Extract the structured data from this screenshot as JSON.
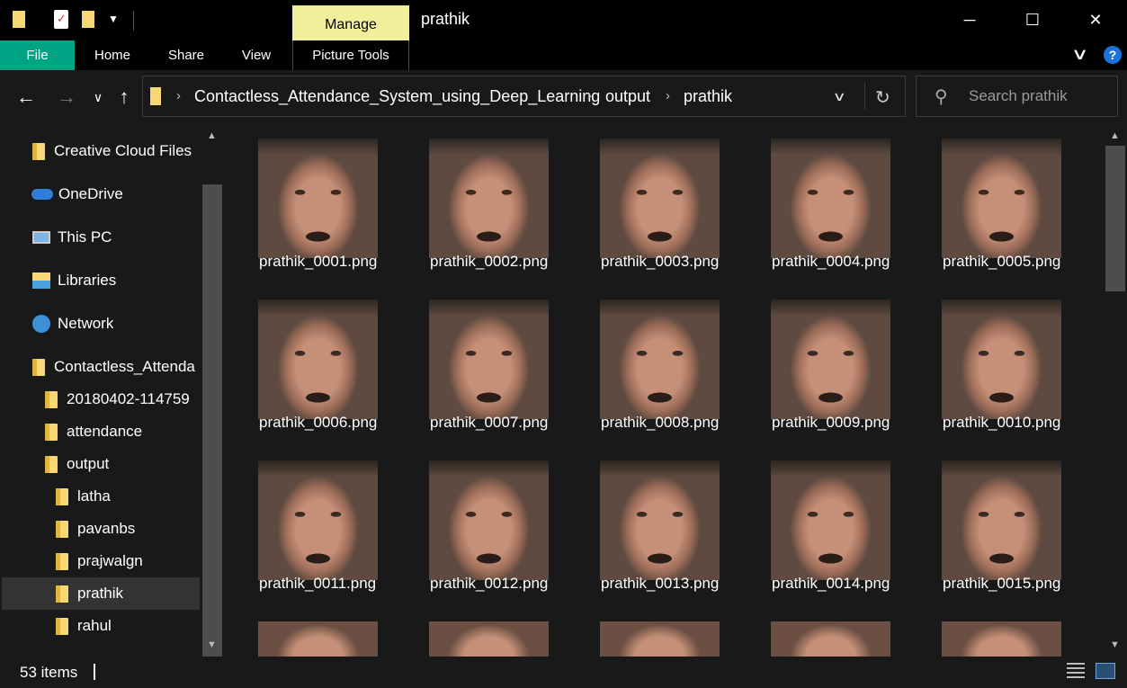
{
  "window": {
    "title": "prathik",
    "contextual_tab": "Manage",
    "controls": {
      "minimize": "─",
      "maximize": "☐",
      "close": "✕"
    }
  },
  "ribbon": {
    "tabs": [
      "File",
      "Home",
      "Share",
      "View",
      "Picture Tools"
    ],
    "collapse_icon": "chevron-down-icon",
    "help_label": "?"
  },
  "address": {
    "crumbs": [
      "Contactless_Attendance_System_using_Deep_Learning",
      "output",
      "prathik"
    ]
  },
  "search": {
    "placeholder": "Search prathik"
  },
  "navigation": {
    "items": [
      {
        "label": "Creative Cloud Files",
        "icon": "creative-cloud-icon"
      },
      {
        "label": "OneDrive",
        "icon": "onedrive-icon"
      },
      {
        "label": "This PC",
        "icon": "this-pc-icon"
      },
      {
        "label": "Libraries",
        "icon": "libraries-icon"
      },
      {
        "label": "Network",
        "icon": "network-icon"
      },
      {
        "label": "Contactless_Attenda",
        "icon": "folder-icon"
      },
      {
        "label": "20180402-114759",
        "icon": "folder-icon"
      },
      {
        "label": "attendance",
        "icon": "folder-icon"
      },
      {
        "label": "output",
        "icon": "folder-icon"
      },
      {
        "label": "latha",
        "icon": "folder-icon"
      },
      {
        "label": "pavanbs",
        "icon": "folder-icon"
      },
      {
        "label": "prajwalgn",
        "icon": "folder-icon"
      },
      {
        "label": "prathik",
        "icon": "folder-icon",
        "selected": true
      },
      {
        "label": "rahul",
        "icon": "folder-icon"
      }
    ]
  },
  "files": [
    "prathik_0001.png",
    "prathik_0002.png",
    "prathik_0003.png",
    "prathik_0004.png",
    "prathik_0005.png",
    "prathik_0006.png",
    "prathik_0007.png",
    "prathik_0008.png",
    "prathik_0009.png",
    "prathik_0010.png",
    "prathik_0011.png",
    "prathik_0012.png",
    "prathik_0013.png",
    "prathik_0014.png",
    "prathik_0015.png"
  ],
  "status": {
    "item_count": "53 items"
  },
  "colors": {
    "file_tab": "#00a383",
    "manage_tab": "#f2ef9b",
    "background": "#191919",
    "selection": "#333333"
  }
}
